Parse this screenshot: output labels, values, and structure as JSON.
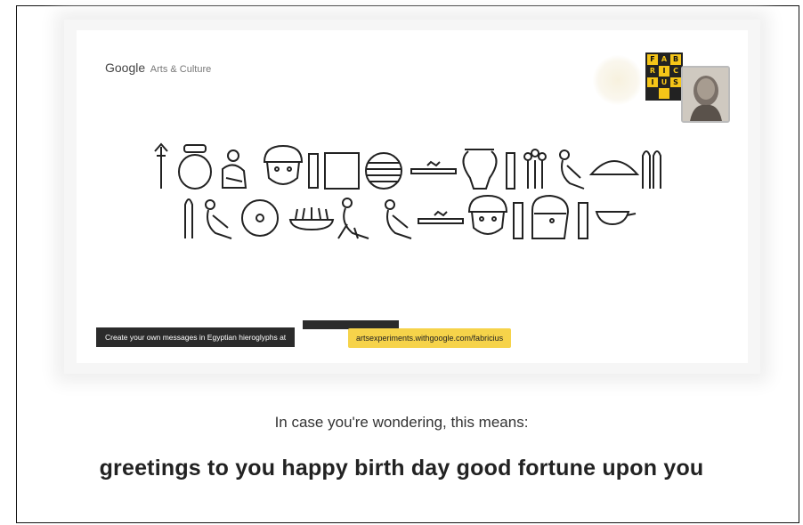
{
  "brand": {
    "google": "Google",
    "product": "Arts & Culture"
  },
  "logo": {
    "letters": [
      "F",
      "A",
      "B",
      "R",
      "I",
      "C",
      "I",
      "U",
      "S"
    ]
  },
  "glyphs": {
    "row1": [
      "reed-staff",
      "pot-ring",
      "seated-man",
      "face",
      "vertical-rect",
      "square",
      "striped-circle",
      "horizontal-bar",
      "jar",
      "vertical-rect",
      "flower-stalks",
      "vulture",
      "half-circle",
      "reed-double"
    ],
    "row2": [
      "reed",
      "vulture",
      "disc-circle",
      "basket-plants",
      "ibis",
      "vulture",
      "horizontal-bar",
      "face",
      "vertical-rect",
      "seated-head",
      "vertical-rect",
      "basket"
    ]
  },
  "footer": {
    "caption": "Create your own messages in Egyptian hieroglyphs at",
    "link": "artsexperiments.withgoogle.com/fabricius"
  },
  "explanation": {
    "intro": "In case you're wondering, this means:",
    "meaning": "greetings to you happy birth day good fortune upon you"
  },
  "colors": {
    "link_highlight": "#f6d34a",
    "caption_bg": "#2b2b2b",
    "logo_yellow": "#f5c518"
  }
}
